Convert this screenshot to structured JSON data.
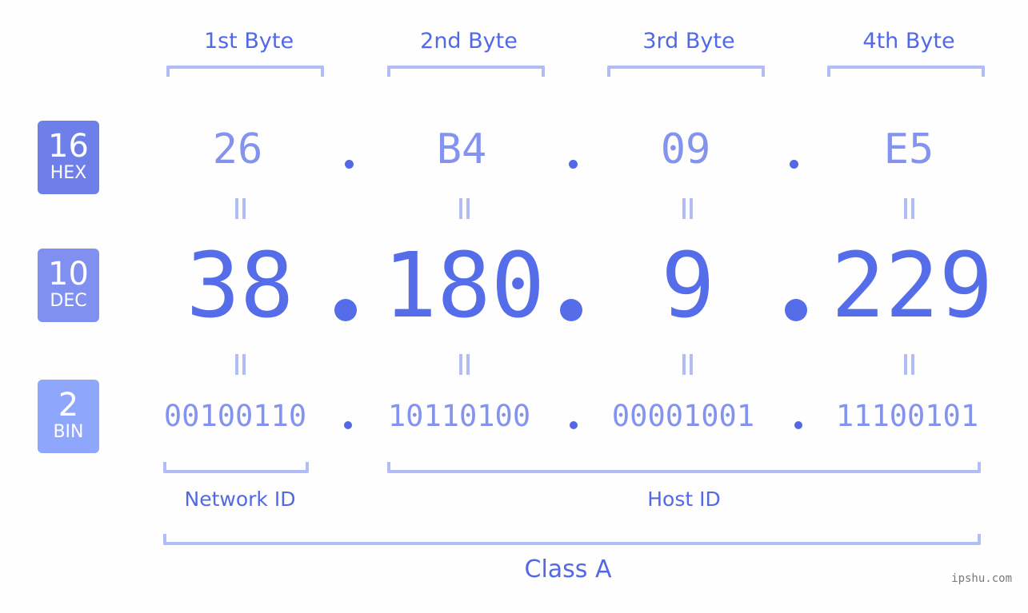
{
  "ip": {
    "dotted_decimal": "38.180.9.229",
    "class": "Class A"
  },
  "byte_headers": [
    "1st Byte",
    "2nd Byte",
    "3rd Byte",
    "4th Byte"
  ],
  "bases": {
    "hex": {
      "number": "16",
      "label": "HEX"
    },
    "dec": {
      "number": "10",
      "label": "DEC"
    },
    "bin": {
      "number": "2",
      "label": "BIN"
    }
  },
  "hex_values": [
    "26",
    "B4",
    "09",
    "E5"
  ],
  "dec_values": [
    "38",
    "180",
    "9",
    "229"
  ],
  "bin_values": [
    "00100110",
    "10110100",
    "00001001",
    "11100101"
  ],
  "separator": ".",
  "segments": {
    "network": "Network ID",
    "host": "Host ID"
  },
  "class_label": "Class A",
  "watermark": "ipshu.com",
  "colors": {
    "accent": "#5368e5",
    "hex_badge": "#6f7fea",
    "dec_badge": "#7f90f1",
    "bin_badge": "#8ea6fc",
    "bracket": "#b2bcf7",
    "background": "#fdfefd"
  }
}
